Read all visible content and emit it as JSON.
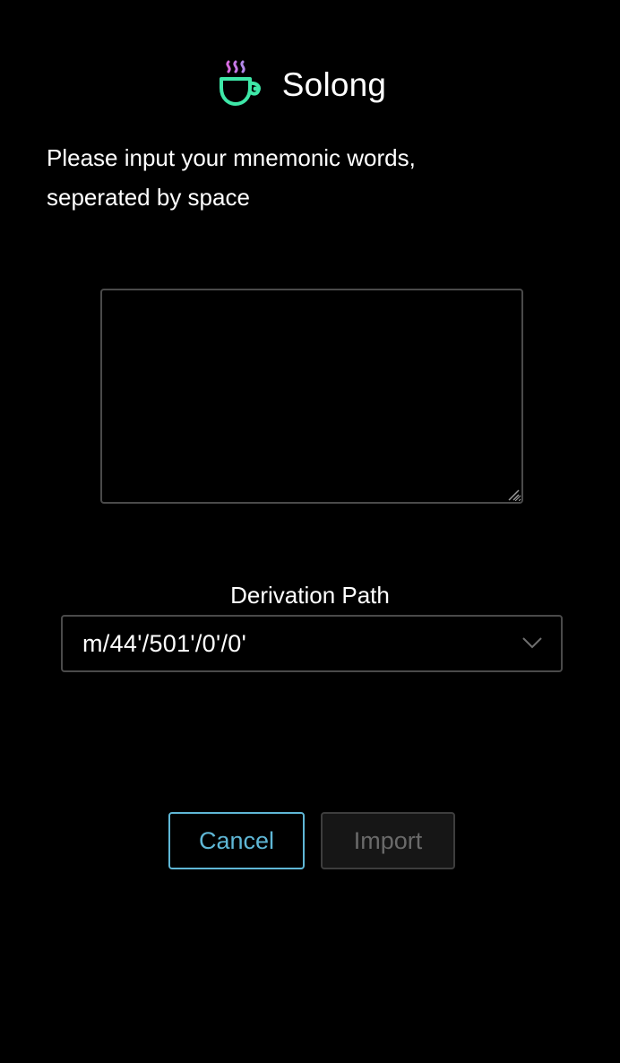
{
  "app": {
    "title": "Solong",
    "logo_icon": "steaming-cup-icon",
    "colors": {
      "accent": "#5fb7d6",
      "logo_green": "#3ee8a8",
      "logo_pink": "#d86be0",
      "background": "#000000"
    }
  },
  "form": {
    "instruction_line1": "Please input your mnemonic words,",
    "instruction_line2": "seperated by space",
    "mnemonic_value": "",
    "derivation_label": "Derivation Path",
    "derivation_selected": "m/44'/501'/0'/0'",
    "dropdown_icon": "chevron-down-icon"
  },
  "actions": {
    "cancel_label": "Cancel",
    "import_label": "Import",
    "import_disabled": true
  }
}
